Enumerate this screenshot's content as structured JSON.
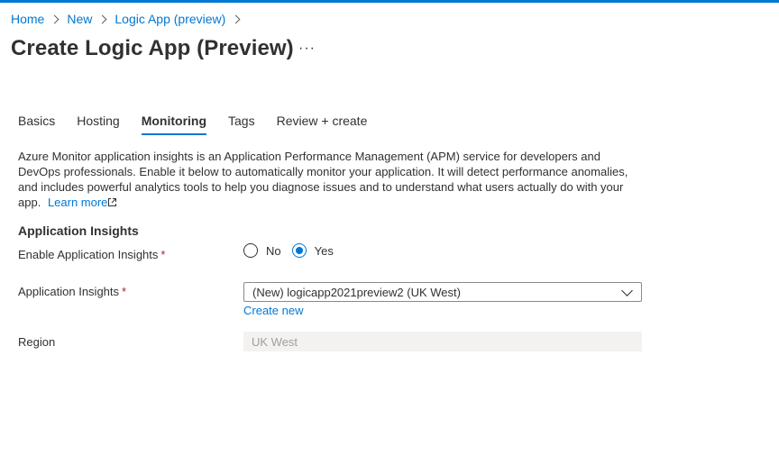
{
  "breadcrumb": [
    "Home",
    "New",
    "Logic App (preview)"
  ],
  "page": {
    "title": "Create Logic App (Preview)",
    "more_label": "···"
  },
  "tabs": [
    "Basics",
    "Hosting",
    "Monitoring",
    "Tags",
    "Review + create"
  ],
  "active_tab": "Monitoring",
  "description": {
    "text": "Azure Monitor application insights is an Application Performance Management (APM) service for developers and DevOps professionals. Enable it below to automatically monitor your application. It will detect performance anomalies, and includes powerful analytics tools to help you diagnose issues and to understand what users actually do with your app.",
    "learn_more": "Learn more"
  },
  "section": {
    "title": "Application Insights"
  },
  "fields": {
    "enable": {
      "label": "Enable Application Insights",
      "required_mark": "*",
      "options": [
        "No",
        "Yes"
      ],
      "selected": "Yes"
    },
    "app_insights": {
      "label": "Application Insights",
      "required_mark": "*",
      "value": "(New) logicapp2021preview2 (UK West)",
      "create_new": "Create new"
    },
    "region": {
      "label": "Region",
      "value": "UK West"
    }
  },
  "colors": {
    "accent": "#0078d4",
    "required": "#a4262c",
    "text": "#323130",
    "disabled_bg": "#f3f2f1"
  }
}
